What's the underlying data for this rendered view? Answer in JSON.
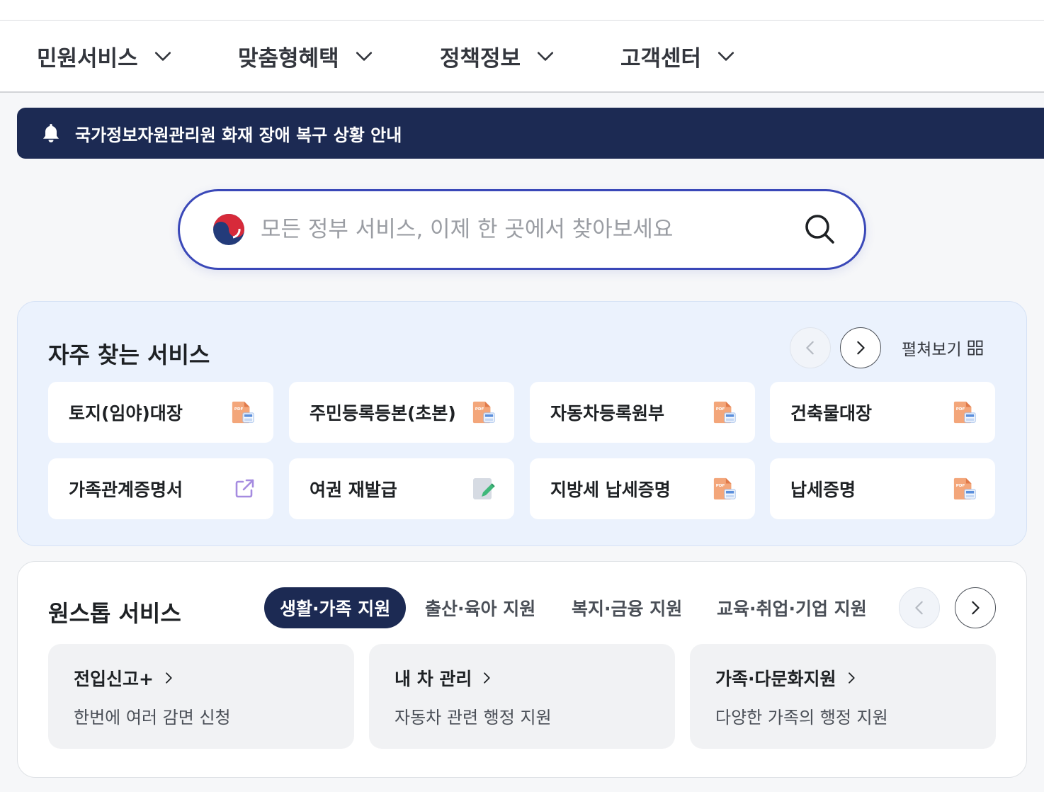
{
  "nav": {
    "items": [
      {
        "label": "민원서비스"
      },
      {
        "label": "맞춤형혜택"
      },
      {
        "label": "정책정보"
      },
      {
        "label": "고객센터"
      }
    ]
  },
  "notice": {
    "text": "국가정보자원관리원 화재 장애 복구 상황 안내",
    "icon": "bell-icon"
  },
  "search": {
    "placeholder": "모든 정부 서비스, 이제 한 곳에서 찾아보세요",
    "value": ""
  },
  "frequent": {
    "title": "자주 찾는 서비스",
    "expand_label": "펼쳐보기",
    "cards": [
      {
        "label": "토지(임야)대장",
        "icon": "pdf-print-icon"
      },
      {
        "label": "주민등록등본(초본)",
        "icon": "pdf-print-icon"
      },
      {
        "label": "자동차등록원부",
        "icon": "pdf-print-icon"
      },
      {
        "label": "건축물대장",
        "icon": "pdf-print-icon"
      },
      {
        "label": "가족관계증명서",
        "icon": "external-link-icon"
      },
      {
        "label": "여권 재발급",
        "icon": "edit-document-icon"
      },
      {
        "label": "지방세 납세증명",
        "icon": "pdf-print-icon"
      },
      {
        "label": "납세증명",
        "icon": "pdf-print-icon"
      }
    ]
  },
  "onestop": {
    "title": "원스톱 서비스",
    "tabs": [
      {
        "label": "생활·가족 지원",
        "active": true
      },
      {
        "label": "출산·육아 지원",
        "active": false
      },
      {
        "label": "복지·금융 지원",
        "active": false
      },
      {
        "label": "교육·취업·기업 지원",
        "active": false
      }
    ],
    "services": [
      {
        "title": "전입신고+",
        "desc": "한번에 여러 감면 신청"
      },
      {
        "title": "내 차 관리",
        "desc": "자동차 관련 행정 지원"
      },
      {
        "title": "가족·다문화지원",
        "desc": "다양한 가족의 행정 지원"
      }
    ]
  },
  "colors": {
    "navy": "#1c2a53",
    "search_border": "#3a48b8",
    "light_blue_panel": "#ebf2fd",
    "pdf_orange": "#f0a070"
  }
}
